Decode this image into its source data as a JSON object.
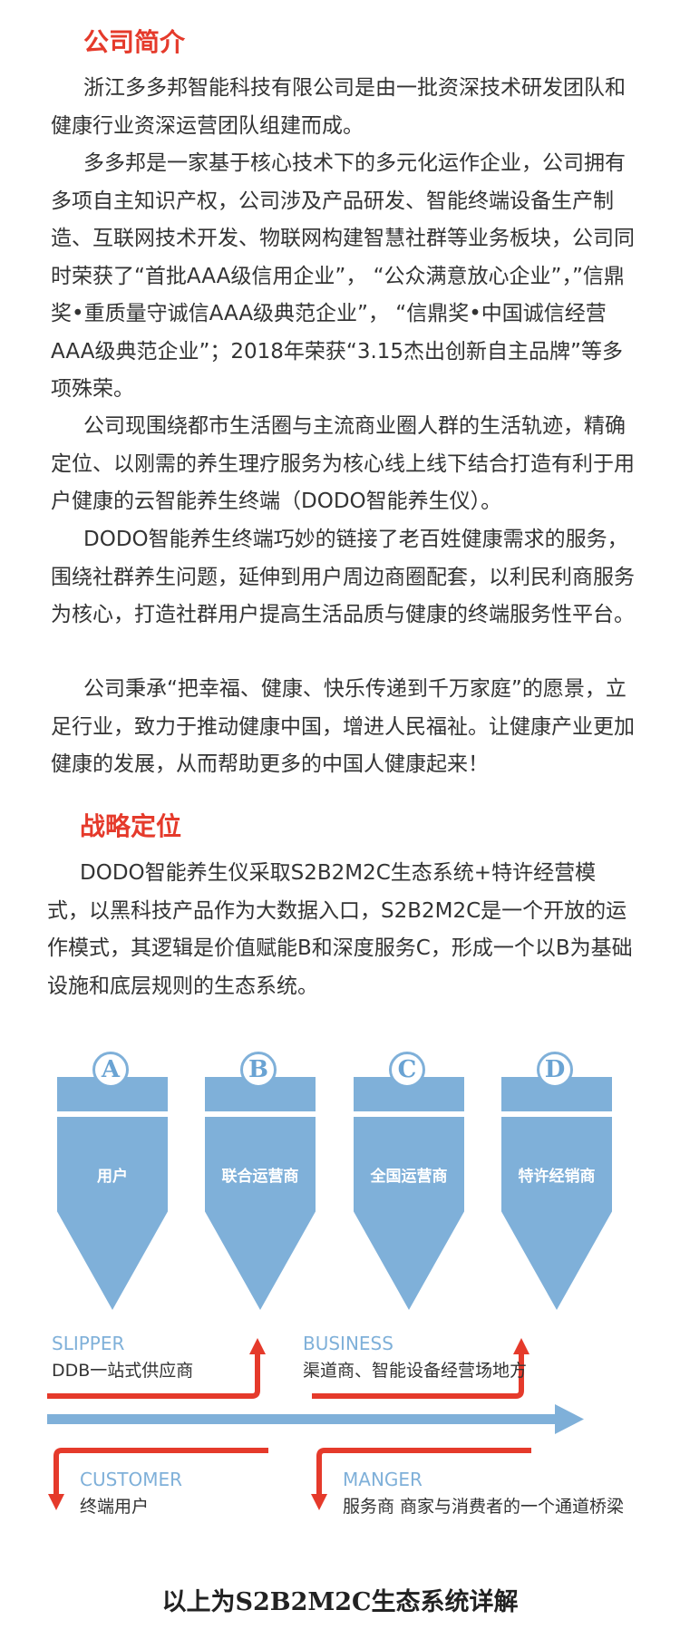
{
  "intro": {
    "title": "公司简介",
    "paragraphs": [
      "浙江多多邦智能科技有限公司是由一批资深技术研发团队和健康行业资深运营团队组建而成。",
      "多多邦是一家基于核心技术下的多元化运作企业，公司拥有多项自主知识产权，公司涉及产品研发、智能终端设备生产制造、互联网技术开发、物联网构建智慧社群等业务板块，公司同时荣获了“首批AAA级信用企业”， “公众满意放心企业”，”信鼎奖•重质量守诚信AAA级典范企业”， “信鼎奖•中国诚信经营AAA级典范企业”；2018年荣获“3.15杰出创新自主品牌”等多项殊荣。",
      "公司现围绕都市生活圈与主流商业圈人群的生活轨迹，精确定位、以刚需的养生理疗服务为核心线上线下结合打造有利于用户健康的云智能养生终端（DODO智能养生仪）。",
      "DODO智能养生终端巧妙的链接了老百姓健康需求的服务，围绕社群养生问题，延伸到用户周边商圈配套，以利民利商服务为核心，打造社群用户提高生活品质与健康的终端服务性平台。",
      "公司秉承“把幸福、健康、快乐传递到千万家庭”的愿景，立足行业，致力于推动健康中国，增进人民福祉。让健康产业更加健康的发展，从而帮助更多的中国人健康起来！"
    ]
  },
  "strategy": {
    "title": "战略定位",
    "paragraph": "DODO智能养生仪采取S2B2M2C生态系统+特许经营模式，以黑科技产品作为大数据入口，S2B2M2C是一个开放的运作模式，其逻辑是价值赋能B和深度服务C，形成一个以B为基础设施和底层规则的生态系统。"
  },
  "cards": [
    {
      "letter": "A",
      "label": "用户"
    },
    {
      "letter": "B",
      "label": "联合运营商"
    },
    {
      "letter": "C",
      "label": "全国运营商"
    },
    {
      "letter": "D",
      "label": "特许经销商"
    }
  ],
  "flow": {
    "slipper": {
      "role": "SLIPPER",
      "desc": "DDB一站式供应商"
    },
    "business": {
      "role": "BUSINESS",
      "desc": "渠道商、智能设备经营场地方"
    },
    "customer": {
      "role": "CUSTOMER",
      "desc": "终端用户"
    },
    "manger": {
      "role": "MANGER",
      "desc": "服务商 商家与消费者的一个通道桥梁"
    }
  },
  "footer": "以上为S2B2M2C生态系统详解",
  "colors": {
    "accent_red": "#e53a2b",
    "accent_blue": "#7fb0d9",
    "text": "#333333"
  }
}
